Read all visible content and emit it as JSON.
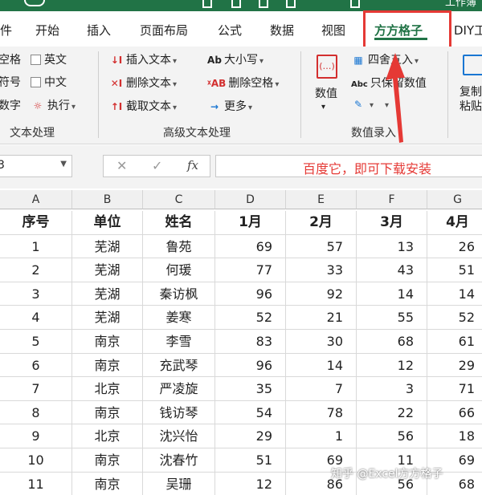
{
  "titlebar": {
    "text": "工作簿"
  },
  "tabs": [
    "件",
    "开始",
    "插入",
    "页面布局",
    "公式",
    "数据",
    "视图",
    "方方格子",
    "DIY工"
  ],
  "ribbon": {
    "text_processing": {
      "items": [
        {
          "left": "空格",
          "right": "英文"
        },
        {
          "left": "符号",
          "right": "中文"
        },
        {
          "left": "数字",
          "right": "执行"
        }
      ],
      "label": "文本处理"
    },
    "advanced_text": {
      "col1": [
        "插入文本",
        "删除文本",
        "截取文本"
      ],
      "col2": [
        "大小写",
        "删除空格",
        "更多"
      ],
      "label": "高级文本处理"
    },
    "numeric": {
      "big_label": "数值",
      "items": [
        "四舍五入",
        "只保留数值"
      ],
      "label": "数值录入"
    },
    "copy_paste": "复制粘贴"
  },
  "formula_bar": {
    "name_box": "3",
    "cancel": "✕",
    "enter": "✓",
    "fx": "fx",
    "content": "百度它，即可下载安装"
  },
  "grid": {
    "columns": [
      "A",
      "B",
      "C",
      "D",
      "E",
      "F",
      "G"
    ],
    "header": [
      "序号",
      "单位",
      "姓名",
      "1月",
      "2月",
      "3月",
      "4月"
    ],
    "rows": [
      [
        "1",
        "芜湖",
        "鲁苑",
        "69",
        "57",
        "13",
        "26"
      ],
      [
        "2",
        "芜湖",
        "何瑗",
        "77",
        "33",
        "43",
        "51"
      ],
      [
        "3",
        "芜湖",
        "秦访枫",
        "96",
        "92",
        "14",
        "14"
      ],
      [
        "4",
        "芜湖",
        "姜寒",
        "52",
        "21",
        "55",
        "52"
      ],
      [
        "5",
        "南京",
        "李雪",
        "83",
        "30",
        "68",
        "61"
      ],
      [
        "6",
        "南京",
        "充武琴",
        "96",
        "14",
        "12",
        "29"
      ],
      [
        "7",
        "北京",
        "严凌旋",
        "35",
        "7",
        "3",
        "71"
      ],
      [
        "8",
        "南京",
        "钱访琴",
        "54",
        "78",
        "22",
        "66"
      ],
      [
        "9",
        "北京",
        "沈兴怡",
        "29",
        "1",
        "56",
        "18"
      ],
      [
        "10",
        "南京",
        "沈春竹",
        "51",
        "69",
        "11",
        "69"
      ],
      [
        "11",
        "南京",
        "吴珊",
        "12",
        "86",
        "56",
        "68"
      ]
    ]
  },
  "watermark": "知乎 @Excel方方格子",
  "colors": {
    "accent": "#217346",
    "highlight": "#e53935"
  }
}
